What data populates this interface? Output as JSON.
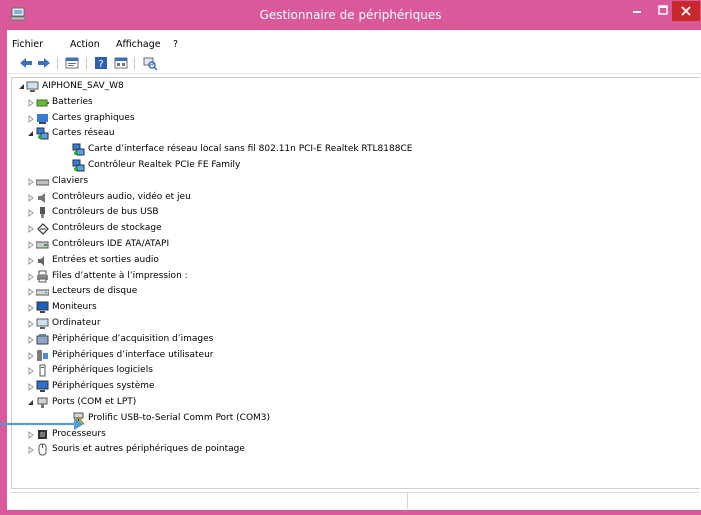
{
  "window": {
    "title": "Gestionnaire de périphériques"
  },
  "menu": [
    "Fichier",
    "Action",
    "Affichage",
    "?"
  ],
  "toolbar": [
    "back-icon",
    "forward-icon",
    "properties-icon",
    "help-icon",
    "view-icon",
    "scan-icon"
  ],
  "colors": {
    "title_bar": "#d9599a",
    "close_button": "#c7282b",
    "arrow": "#5a9bd5"
  },
  "tree": [
    {
      "label": "AIPHONE_SAV_W8",
      "level": 0,
      "state": "expanded",
      "icon": "computer-icon"
    },
    {
      "label": "Batteries",
      "level": 1,
      "state": "collapsed",
      "icon": "battery-icon"
    },
    {
      "label": "Cartes graphiques",
      "level": 1,
      "state": "collapsed",
      "icon": "display-adapter-icon"
    },
    {
      "label": "Cartes réseau",
      "level": 1,
      "state": "expanded",
      "icon": "network-adapter-icon"
    },
    {
      "label": "Carte d’interface réseau local sans fil 802.11n PCI-E Realtek RTL8188CE",
      "level": 2,
      "state": "leaf",
      "icon": "network-adapter-icon"
    },
    {
      "label": "Contrôleur Realtek PCIe FE Family",
      "level": 2,
      "state": "leaf",
      "icon": "network-adapter-icon"
    },
    {
      "label": "Claviers",
      "level": 1,
      "state": "collapsed",
      "icon": "keyboard-icon"
    },
    {
      "label": "Contrôleurs audio, vidéo et jeu",
      "level": 1,
      "state": "collapsed",
      "icon": "speaker-icon"
    },
    {
      "label": "Contrôleurs de bus USB",
      "level": 1,
      "state": "collapsed",
      "icon": "usb-icon"
    },
    {
      "label": "Contrôleurs de stockage",
      "level": 1,
      "state": "collapsed",
      "icon": "storage-icon"
    },
    {
      "label": "Contrôleurs IDE ATA/ATAPI",
      "level": 1,
      "state": "collapsed",
      "icon": "ide-icon"
    },
    {
      "label": "Entrées et sorties audio",
      "level": 1,
      "state": "collapsed",
      "icon": "audio-io-icon"
    },
    {
      "label": "Files d’attente à l’impression :",
      "level": 1,
      "state": "collapsed",
      "icon": "printer-icon"
    },
    {
      "label": "Lecteurs de disque",
      "level": 1,
      "state": "collapsed",
      "icon": "disk-drive-icon"
    },
    {
      "label": "Moniteurs",
      "level": 1,
      "state": "collapsed",
      "icon": "monitor-icon"
    },
    {
      "label": "Ordinateur",
      "level": 1,
      "state": "collapsed",
      "icon": "computer-icon"
    },
    {
      "label": "Périphérique d’acquisition d’images",
      "level": 1,
      "state": "collapsed",
      "icon": "camera-icon"
    },
    {
      "label": "Périphériques d’interface utilisateur",
      "level": 1,
      "state": "collapsed",
      "icon": "hid-icon"
    },
    {
      "label": "Périphériques logiciels",
      "level": 1,
      "state": "collapsed",
      "icon": "software-device-icon"
    },
    {
      "label": "Périphériques système",
      "level": 1,
      "state": "collapsed",
      "icon": "system-device-icon"
    },
    {
      "label": "Ports (COM et LPT)",
      "level": 1,
      "state": "expanded",
      "icon": "port-icon"
    },
    {
      "label": "Prolific USB-to-Serial Comm Port (COM3)",
      "level": 2,
      "state": "leaf",
      "icon": "port-warning-icon"
    },
    {
      "label": "Processeurs",
      "level": 1,
      "state": "collapsed",
      "icon": "processor-icon"
    },
    {
      "label": "Souris et autres périphériques de pointage",
      "level": 1,
      "state": "collapsed",
      "icon": "mouse-icon"
    }
  ]
}
